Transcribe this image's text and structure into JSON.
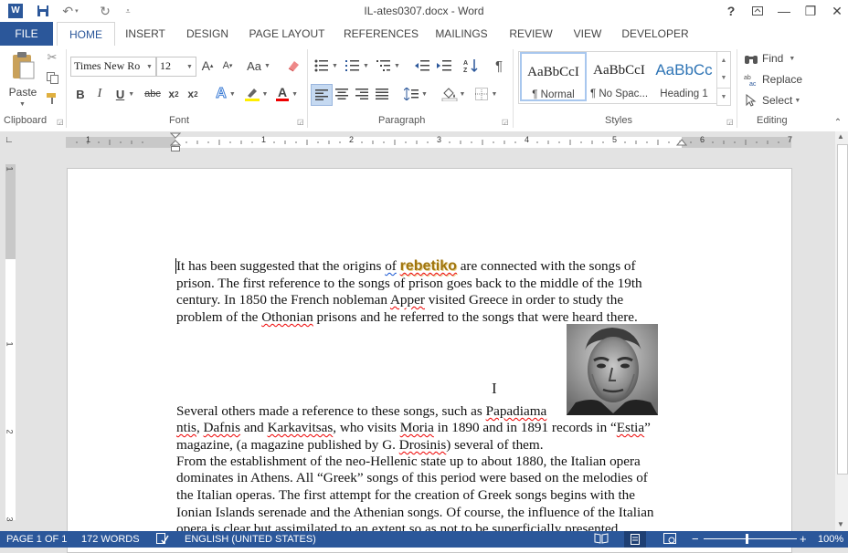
{
  "window": {
    "title": "IL-ates0307.docx - Word",
    "help": "?",
    "ribbon_display_icon": "ribbon-display-options-icon",
    "minimize": "—",
    "restore": "❐",
    "close": "✕"
  },
  "quick_access": {
    "app_icon": "word-icon",
    "save_icon": "save-icon",
    "undo_icon": "undo-icon",
    "redo_icon": "redo-icon",
    "customize_icon": "customize-qat-icon"
  },
  "tabs": [
    {
      "label": "FILE"
    },
    {
      "label": "HOME"
    },
    {
      "label": "INSERT"
    },
    {
      "label": "DESIGN"
    },
    {
      "label": "PAGE LAYOUT"
    },
    {
      "label": "REFERENCES"
    },
    {
      "label": "MAILINGS"
    },
    {
      "label": "REVIEW"
    },
    {
      "label": "VIEW"
    },
    {
      "label": "DEVELOPER"
    }
  ],
  "ribbon": {
    "clipboard": {
      "label": "Clipboard",
      "paste": "Paste"
    },
    "font": {
      "label": "Font",
      "font_name": "Times New Ro",
      "font_size": "12",
      "grow": "A",
      "shrink": "A",
      "change_case": "Aa",
      "bold": "B",
      "italic": "I",
      "underline": "U",
      "strike": "abc",
      "subscript": "x",
      "superscript": "x",
      "sub_mark": "2",
      "sup_mark": "2",
      "text_effects": "A",
      "font_color": "A"
    },
    "paragraph": {
      "label": "Paragraph",
      "pilcrow": "¶"
    },
    "styles": {
      "label": "Styles",
      "items": [
        {
          "preview": "AaBbCcI",
          "name": "¶ Normal"
        },
        {
          "preview": "AaBbCcI",
          "name": "¶ No Spac..."
        },
        {
          "preview": "AaBbCc",
          "name": "Heading 1"
        }
      ]
    },
    "editing": {
      "label": "Editing",
      "find": "Find",
      "replace": "Replace",
      "select": "Select"
    }
  },
  "ruler": {
    "numbers": [
      "1",
      "1",
      "2",
      "3",
      "4",
      "5",
      "6",
      "7"
    ]
  },
  "vertical_ruler": {
    "numbers": [
      "1",
      "1",
      "2",
      "3"
    ]
  },
  "document": {
    "p1": {
      "l1_a": "It has been suggested that the origins ",
      "l1_of": "of",
      "l1_word": "rebetiko",
      "l1_b": " are connected with the songs of",
      "l2": "prison. The first reference to the songs of prison goes back to the middle of the 19th",
      "l3_a": "century. In 1850 the French nobleman ",
      "l3_apper": "Apper",
      "l3_b": " visited Greece in order to study the",
      "l4_a": "problem of the ",
      "l4_oth": "Othonian",
      "l4_b": " prisons and he referred to the songs that were heard there."
    },
    "p2": {
      "l1_a": "Several others made a reference to these songs, such as ",
      "l1_pap": "Papadiama",
      "l2_ntis": "ntis",
      "l2_c1": ", ",
      "l2_daf": "Dafnis",
      "l2_and": " and ",
      "l2_kar": "Karkavitsas",
      "l2_mid": ", who visits ",
      "l2_mor": "Moria",
      "l2_mid2": " in 1890 and in 1891 records in “",
      "l2_est": "Estia",
      "l2_end": "”",
      "l3_a": "magazine, (a magazine published by G. ",
      "l3_dro": "Drosinis",
      "l3_b": ") several of them."
    },
    "p3": {
      "l1": "From the establishment of the neo-Hellenic state up to about 1880, the Italian opera",
      "l2": "dominates in Athens. All “Greek” songs of this period were based on the melodies of",
      "l3": "the Italian operas. The first attempt for the creation of Greek songs begins with the",
      "l4": "Ionian Islands serenade and the Athenian songs. Of course, the influence of the Italian",
      "l5": "opera is clear but assimilated to an extent so as not to be superficially presented."
    },
    "image": "portrait-photo"
  },
  "status": {
    "page": "PAGE 1 OF 1",
    "words": "172 WORDS",
    "language": "ENGLISH (UNITED STATES)",
    "zoom": "100%",
    "zoom_minus": "−",
    "zoom_plus": "+"
  },
  "colors": {
    "accent": "#2b579a",
    "wordart": "#a0750f"
  }
}
